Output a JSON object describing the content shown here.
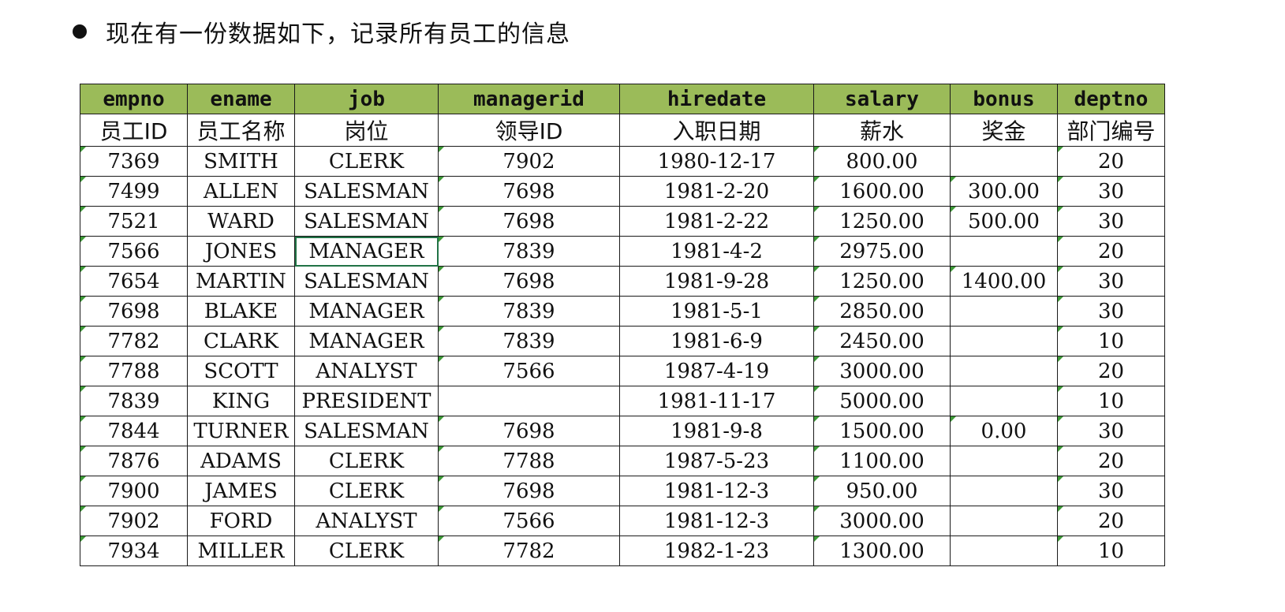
{
  "heading": "现在有一份数据如下，记录所有员工的信息",
  "colors": {
    "header_bg": "#9bbb59",
    "border": "#1a1a1a",
    "cell_marker": "#3d9a37",
    "selection": "#217346"
  },
  "table": {
    "columns": [
      {
        "field": "empno",
        "label": "员工ID"
      },
      {
        "field": "ename",
        "label": "员工名称"
      },
      {
        "field": "job",
        "label": "岗位"
      },
      {
        "field": "managerid",
        "label": "领导ID"
      },
      {
        "field": "hiredate",
        "label": "入职日期"
      },
      {
        "field": "salary",
        "label": "薪水"
      },
      {
        "field": "bonus",
        "label": "奖金"
      },
      {
        "field": "deptno",
        "label": "部门编号"
      }
    ],
    "rows": [
      [
        "7369",
        "SMITH",
        "CLERK",
        "7902",
        "1980-12-17",
        "800.00",
        "",
        "20"
      ],
      [
        "7499",
        "ALLEN",
        "SALESMAN",
        "7698",
        "1981-2-20",
        "1600.00",
        "300.00",
        "30"
      ],
      [
        "7521",
        "WARD",
        "SALESMAN",
        "7698",
        "1981-2-22",
        "1250.00",
        "500.00",
        "30"
      ],
      [
        "7566",
        "JONES",
        "MANAGER",
        "7839",
        "1981-4-2",
        "2975.00",
        "",
        "20"
      ],
      [
        "7654",
        "MARTIN",
        "SALESMAN",
        "7698",
        "1981-9-28",
        "1250.00",
        "1400.00",
        "30"
      ],
      [
        "7698",
        "BLAKE",
        "MANAGER",
        "7839",
        "1981-5-1",
        "2850.00",
        "",
        "30"
      ],
      [
        "7782",
        "CLARK",
        "MANAGER",
        "7839",
        "1981-6-9",
        "2450.00",
        "",
        "10"
      ],
      [
        "7788",
        "SCOTT",
        "ANALYST",
        "7566",
        "1987-4-19",
        "3000.00",
        "",
        "20"
      ],
      [
        "7839",
        "KING",
        "PRESIDENT",
        "",
        "1981-11-17",
        "5000.00",
        "",
        "10"
      ],
      [
        "7844",
        "TURNER",
        "SALESMAN",
        "7698",
        "1981-9-8",
        "1500.00",
        "0.00",
        "30"
      ],
      [
        "7876",
        "ADAMS",
        "CLERK",
        "7788",
        "1987-5-23",
        "1100.00",
        "",
        "20"
      ],
      [
        "7900",
        "JAMES",
        "CLERK",
        "7698",
        "1981-12-3",
        "950.00",
        "",
        "30"
      ],
      [
        "7902",
        "FORD",
        "ANALYST",
        "7566",
        "1981-12-3",
        "3000.00",
        "",
        "20"
      ],
      [
        "7934",
        "MILLER",
        "CLERK",
        "7782",
        "1982-1-23",
        "1300.00",
        "",
        "10"
      ]
    ]
  }
}
